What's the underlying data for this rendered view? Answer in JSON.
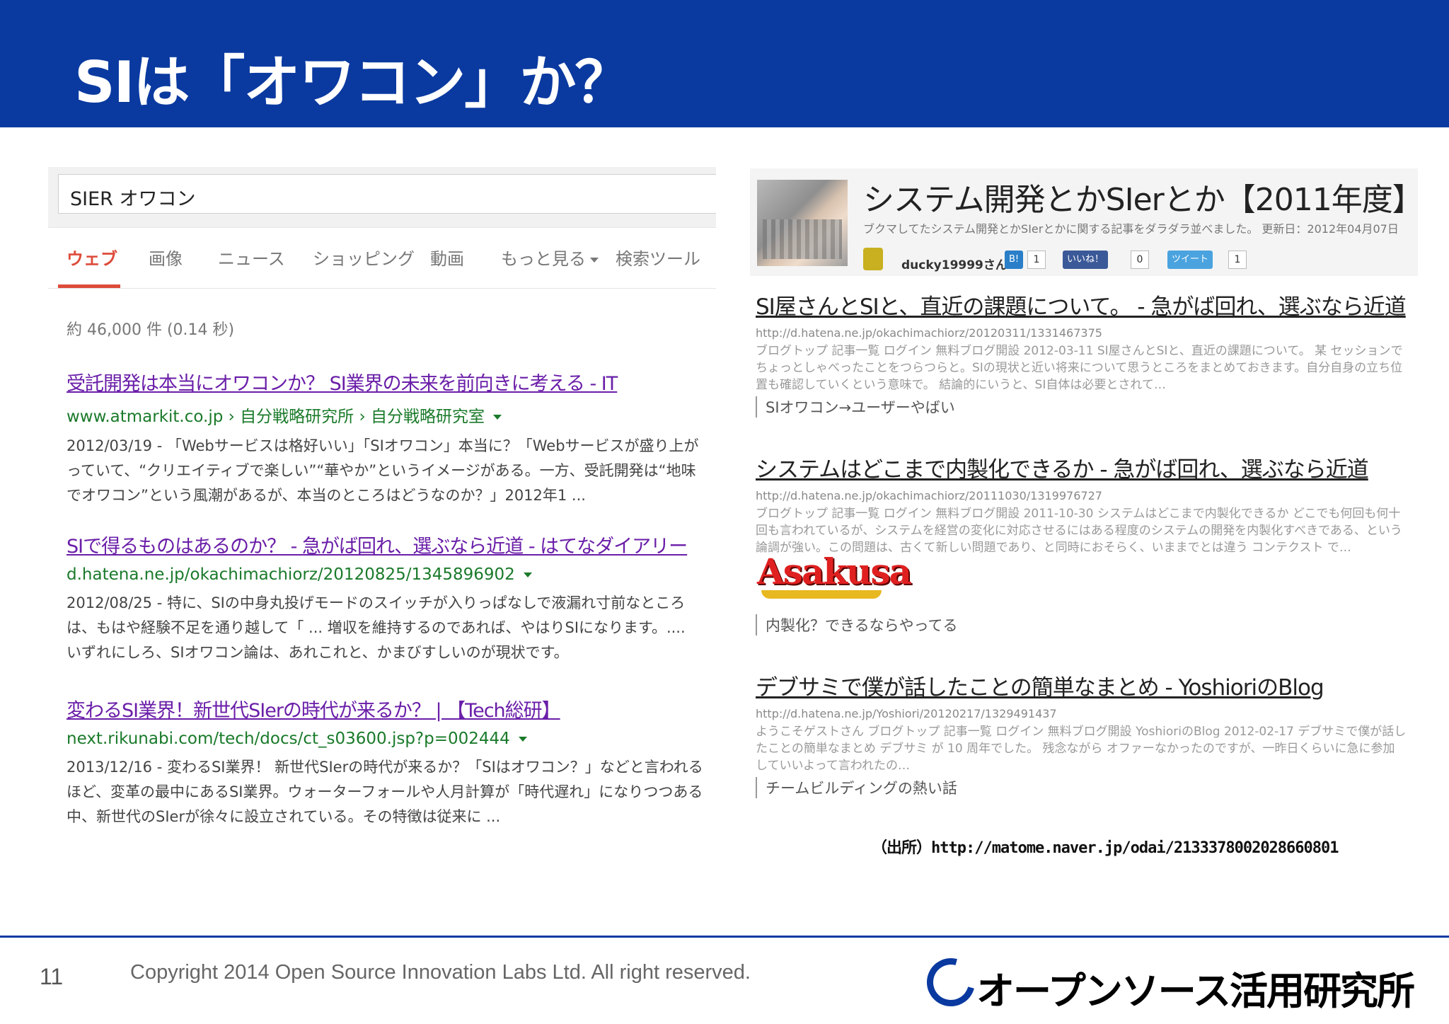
{
  "slide": {
    "title": "SIは「オワコン」か？",
    "page_number": "11",
    "copyright": "Copyright 2014 Open Source Innovation Labs Ltd. All right reserved.",
    "logo_text": "オープンソース活用研究所",
    "source": "（出所）http://matome.naver.jp/odai/2133378002028660801"
  },
  "google": {
    "query": "SIER オワコン",
    "tabs": [
      "ウェブ",
      "画像",
      "ニュース",
      "ショッピング",
      "動画",
      "もっと見る",
      "検索ツール"
    ],
    "result_count": "約 46,000 件 (0.14 秒)",
    "results": [
      {
        "title": "受託開発は本当にオワコンか？ SI業界の未来を前向きに考える - IT",
        "url": "www.atmarkit.co.jp › 自分戦略研究所 › 自分戦略研究室",
        "snippet": "2012/03/19 - 「Webサービスは格好いい」「SIオワコン」本当に？「Webサービスが盛り上がっていて、“クリエイティブで楽しい”“華やか”というイメージがある。一方、受託開発は“地味でオワコン”という風潮があるが、本当のところはどうなのか？」2012年1 ..."
      },
      {
        "title": "SIで得るものはあるのか？ - 急がば回れ、選ぶなら近道 - はてなダイアリー",
        "url": "d.hatena.ne.jp/okachimachiorz/20120825/1345896902",
        "snippet": "2012/08/25 - 特に、SIの中身丸投げモードのスイッチが入りっぱなしで液漏れ寸前なところは、もはや経験不足を通り越して「 ... 増収を維持するのであれば、やはりSIになります。.... いずれにしろ、SIオワコン論は、あれこれと、かまびすしいのが現状です。"
      },
      {
        "title": "変わるSI業界！新世代SIerの時代が来るか？ | 【Tech総研】",
        "url": "next.rikunabi.com/tech/docs/ct_s03600.jsp?p=002444",
        "snippet": "2013/12/16 - 変わるSI業界！ 新世代SIerの時代が来るか？「SIはオワコン？」などと言われるほど、変革の最中にあるSI業界。ウォーターフォールや人月計算が「時代遅れ」になりつつある中、新世代のSIerが徐々に設立されている。その特徴は従来に ..."
      }
    ]
  },
  "hatena": {
    "title": "システム開発とかSIerとか【2011年度】",
    "description": "ブクマしてたシステム開発とかSIerとかに関する記事をダラダラ並べました。 更新日：2012年04月07日",
    "user": "ducky19999さん",
    "badges": [
      {
        "label": "B!",
        "count": "1",
        "color": "#2a7fc8"
      },
      {
        "label": "いいね！",
        "count": "0",
        "color": "#3b5998"
      },
      {
        "label": "ツイート",
        "count": "1",
        "color": "#4aa3df"
      }
    ],
    "items": [
      {
        "title": "SI屋さんとSIと、直近の課題について。 - 急がば回れ、選ぶなら近道",
        "url": "http://d.hatena.ne.jp/okachimachiorz/20120311/1331467375",
        "body": "ブログトップ 記事一覧 ログイン 無料ブログ開設 2012-03-11 SI屋さんとSIと、直近の課題について。 某 セッションでちょっとしゃべったことをつらつらと。SIの現状と近い将来について思うところをまとめておきます。自分自身の立ち位置も確認していくという意味で。 結論的にいうと、SI自体は必要とされて…",
        "comment": "SIオワコン→ユーザーやばい"
      },
      {
        "title": "システムはどこまで内製化できるか - 急がば回れ、選ぶなら近道",
        "url": "http://d.hatena.ne.jp/okachimachiorz/20111030/1319976727",
        "body": "ブログトップ 記事一覧 ログイン 無料ブログ開設 2011-10-30 システムはどこまで内製化できるか どこでも何回も何十回も言われているが、システムを経営の変化に対応させるにはある程度のシステムの開発を内製化すべきである、という論調が強い。この問題は、古くて新しい問題であり、と同時におそらく、いままでとは違う コンテクスト で…",
        "logo": "Asakusa",
        "comment": "内製化？できるならやってる"
      },
      {
        "title": "デブサミで僕が話したことの簡単なまとめ - YoshioriのBlog",
        "url": "http://d.hatena.ne.jp/Yoshiori/20120217/1329491437",
        "body": "ようこそゲストさん ブログトップ 記事一覧 ログイン 無料ブログ開設 YoshioriのBlog 2012-02-17 デブサミで僕が話したことの簡単なまとめ デブサミ が 10 周年でした。 残念ながら オファーなかったのですが、一昨日くらいに急に参加していいよって言われたの…",
        "comment": "チームビルディングの熱い話"
      }
    ]
  }
}
